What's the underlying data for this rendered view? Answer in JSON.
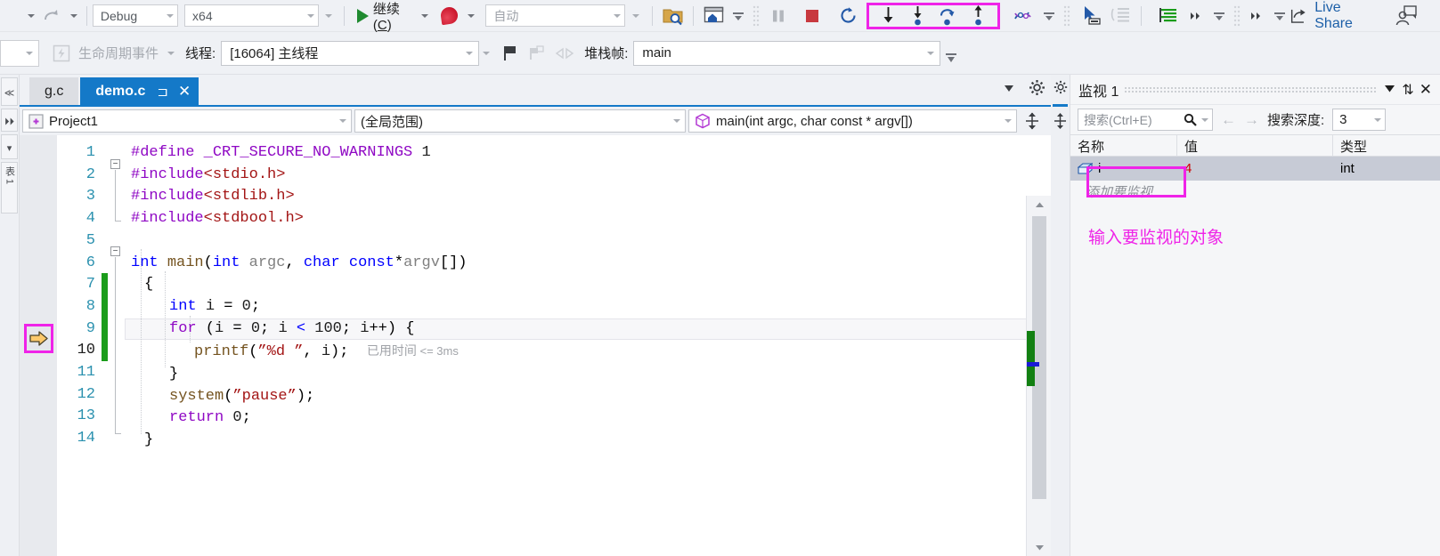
{
  "toolbar1": {
    "config_combo": {
      "value": "Debug"
    },
    "platform_combo": {
      "value": "x64"
    },
    "continue_label_pre": "继续",
    "continue_label_key": "C",
    "continue_label_post": "",
    "auto_combo": {
      "value": "自动"
    },
    "live_share_label": "Live Share"
  },
  "toolbar2": {
    "lifecycle_label": "生命周期事件",
    "thread_label": "线程:",
    "thread_value": "[16064] 主线程",
    "stackframe_label": "堆栈帧:",
    "stackframe_value": "main"
  },
  "editor": {
    "tabs": [
      {
        "label": "g.c",
        "active": false
      },
      {
        "label": "demo.c",
        "active": true,
        "pin": "⊐",
        "close": "✕"
      }
    ],
    "nav": {
      "project": "Project1",
      "scope": "(全局范围)",
      "member": "main(int argc, char const * argv[])"
    },
    "line_numbers": [
      "1",
      "2",
      "3",
      "4",
      "5",
      "6",
      "7",
      "8",
      "9",
      "10",
      "11",
      "12",
      "13",
      "14"
    ],
    "current_line": 10,
    "inline_diagnostic": {
      "cn": "已用时间",
      "value": "<= 3ms"
    }
  },
  "watch": {
    "title": "监视 1",
    "search_placeholder": "搜索(Ctrl+E)",
    "depth_label": "搜索深度:",
    "depth_value": "3",
    "columns": {
      "name": "名称",
      "value": "值",
      "type": "类型"
    },
    "rows": [
      {
        "name": "i",
        "value": "4",
        "type": "int",
        "changed": true
      }
    ],
    "add_watch_placeholder": "添加要监视...",
    "annotation": "输入要监视的对象"
  },
  "left_strip": {
    "label": "表 1"
  },
  "colors": {
    "accent_blue": "#1479c8",
    "highlight_magenta": "#ef23e8",
    "changed_value_red": "#cc0000",
    "changebar_green": "#1a9c1a",
    "exec_arrow_yellow": "#fcc96b"
  }
}
